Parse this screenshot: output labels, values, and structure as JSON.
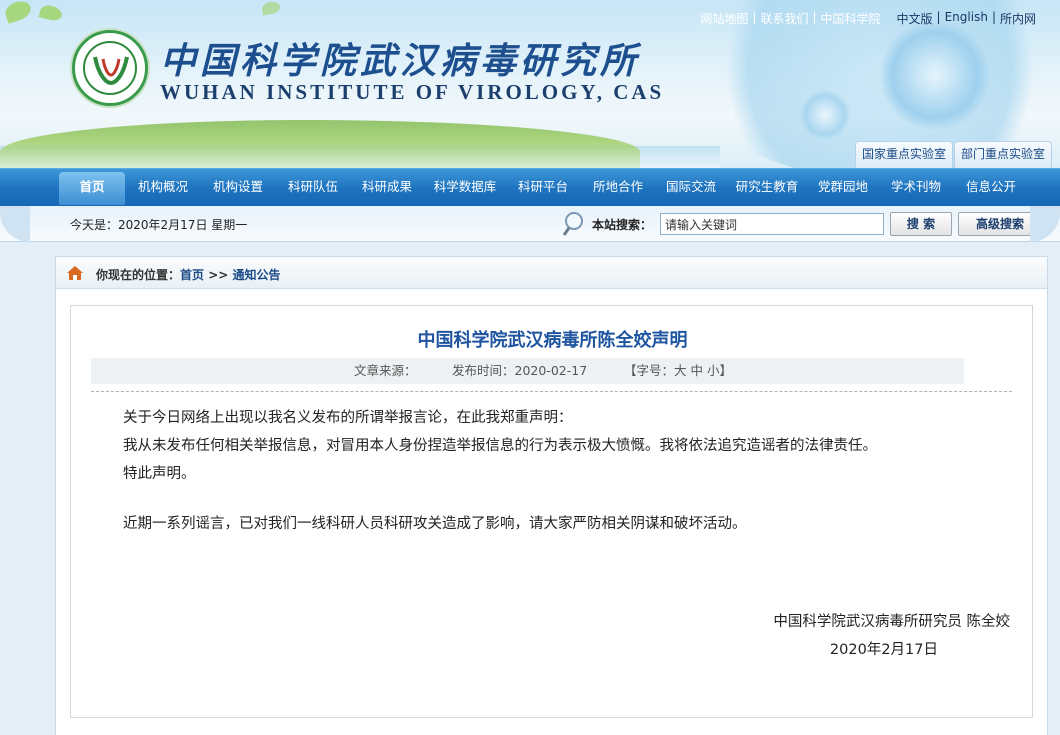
{
  "header": {
    "site_name_cn": "中国科学院武汉病毒研究所",
    "site_name_en": "WUHAN INSTITUTE OF VIROLOGY, CAS",
    "top_links": [
      "网站地图",
      "联系我们",
      "中国科学院"
    ],
    "lang_links": [
      "中文版",
      "English",
      "所内网"
    ],
    "lab_tabs": [
      "国家重点实验室",
      "部门重点实验室"
    ]
  },
  "nav": {
    "items": [
      "首页",
      "机构概况",
      "机构设置",
      "科研队伍",
      "科研成果",
      "科学数据库",
      "科研平台",
      "所地合作",
      "国际交流",
      "研究生教育",
      "党群园地",
      "学术刊物",
      "信息公开"
    ],
    "active_index": 0
  },
  "subbar": {
    "today": "今天是：2020年2月17日 星期一",
    "search_label": "本站搜索：",
    "search_value": "请输入关键词",
    "search_button": "搜 索",
    "advanced_button": "高级搜索"
  },
  "breadcrumb": {
    "prefix": "你现在的位置：",
    "home": "首页",
    "sep": ">>",
    "current": "通知公告"
  },
  "article": {
    "title": "中国科学院武汉病毒所陈全姣声明",
    "source_label": "文章来源：",
    "time_label": "发布时间：2020-02-17",
    "font_size_label": "【字号：大 中 小】",
    "paragraphs": [
      "关于今日网络上出现以我名义发布的所谓举报言论，在此我郑重声明：",
      "我从未发布任何相关举报信息，对冒用本人身份捏造举报信息的行为表示极大愤慨。我将依法追究造谣者的法律责任。",
      "特此声明。",
      "近期一系列谣言，已对我们一线科研人员科研攻关造成了影响，请大家严防相关阴谋和破坏活动。"
    ],
    "signature": "中国科学院武汉病毒所研究员 陈全姣",
    "date": "2020年2月17日"
  },
  "colors": {
    "nav_blue": "#1f74c0",
    "title_blue": "#1f55a0",
    "logo_green": "#3a9b4c"
  }
}
